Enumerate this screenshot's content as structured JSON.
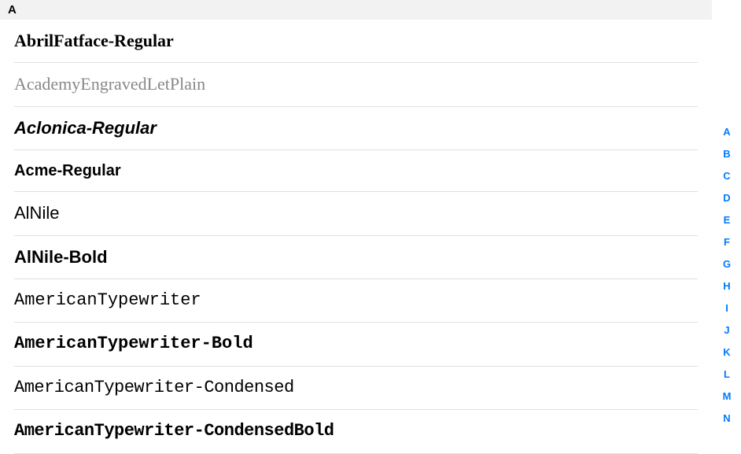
{
  "section_header": "A",
  "fonts": [
    "AbrilFatface-Regular",
    "AcademyEngravedLetPlain",
    "Aclonica-Regular",
    "Acme-Regular",
    "AlNile",
    "AlNile-Bold",
    "AmericanTypewriter",
    "AmericanTypewriter-Bold",
    "AmericanTypewriter-Condensed",
    "AmericanTypewriter-CondensedBold"
  ],
  "alpha_index": [
    "A",
    "B",
    "C",
    "D",
    "E",
    "F",
    "G",
    "H",
    "I",
    "J",
    "K",
    "L",
    "M",
    "N"
  ]
}
